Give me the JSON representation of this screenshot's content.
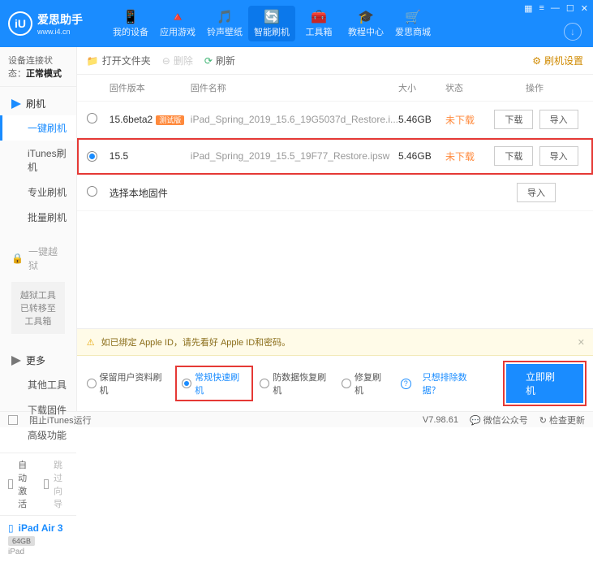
{
  "brand": {
    "cn": "爱思助手",
    "url": "www.i4.cn",
    "logo_letter": "iU"
  },
  "nav": {
    "items": [
      {
        "label": "我的设备",
        "icon": "📱"
      },
      {
        "label": "应用游戏",
        "icon": "🔺"
      },
      {
        "label": "铃声壁纸",
        "icon": "🎵"
      },
      {
        "label": "智能刷机",
        "icon": "🔄"
      },
      {
        "label": "工具箱",
        "icon": "🧰"
      },
      {
        "label": "教程中心",
        "icon": "🎓"
      },
      {
        "label": "爱思商城",
        "icon": "🛒"
      }
    ],
    "active_index": 3
  },
  "sidebar": {
    "conn_label": "设备连接状态：",
    "conn_value": "正常模式",
    "groups": {
      "flash": {
        "title": "刷机",
        "items": [
          "一键刷机",
          "iTunes刷机",
          "专业刷机",
          "批量刷机"
        ]
      },
      "jailbreak": {
        "title": "一键越狱",
        "note": "越狱工具已转移至工具箱"
      },
      "more": {
        "title": "更多",
        "items": [
          "其他工具",
          "下载固件",
          "高级功能"
        ]
      }
    },
    "auto_activate": "自动激活",
    "skip_guide": "跳过向导",
    "device": {
      "name": "iPad Air 3",
      "storage": "64GB",
      "type": "iPad"
    }
  },
  "toolbar": {
    "open_folder": "打开文件夹",
    "delete": "删除",
    "refresh": "刷新",
    "settings": "刷机设置"
  },
  "table": {
    "headers": {
      "version": "固件版本",
      "name": "固件名称",
      "size": "大小",
      "status": "状态",
      "ops": "操作"
    },
    "rows": [
      {
        "version": "15.6beta2",
        "beta": "测试版",
        "name": "iPad_Spring_2019_15.6_19G5037d_Restore.i...",
        "size": "5.46GB",
        "status": "未下载",
        "selected": false
      },
      {
        "version": "15.5",
        "beta": "",
        "name": "iPad_Spring_2019_15.5_19F77_Restore.ipsw",
        "size": "5.46GB",
        "status": "未下载",
        "selected": true
      }
    ],
    "local_firmware": "选择本地固件",
    "btn_download": "下载",
    "btn_import": "导入"
  },
  "bottom": {
    "warn": "如已绑定 Apple ID，请先看好 Apple ID和密码。",
    "modes": [
      "保留用户资料刷机",
      "常规快速刷机",
      "防数据恢复刷机",
      "修复刷机"
    ],
    "mode_selected": 1,
    "exclude_link": "只想排除数据？",
    "flash_btn": "立即刷机"
  },
  "statusbar": {
    "block_itunes": "阻止iTunes运行",
    "version": "V7.98.61",
    "wechat": "微信公众号",
    "check_update": "检查更新"
  }
}
